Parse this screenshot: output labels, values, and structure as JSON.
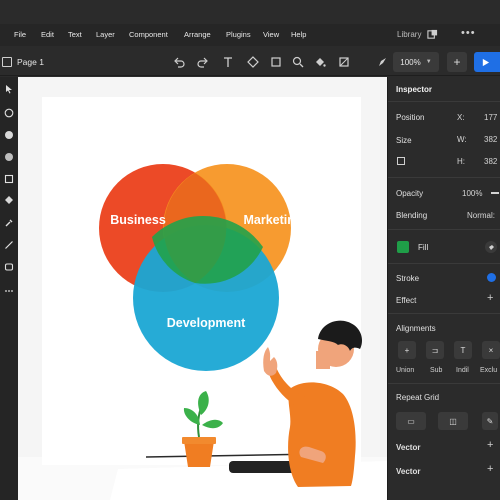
{
  "menu": {
    "items": [
      "File",
      "Edit",
      "Text",
      "Layer",
      "Component",
      "Arrange",
      "Plugins",
      "View",
      "Help"
    ],
    "library_label": "Library",
    "more_glyph": "•••"
  },
  "toolbar": {
    "page_label": "Page 1",
    "zoom_value": "100%",
    "add_glyph": "+"
  },
  "canvas": {
    "venn": {
      "labels": [
        "Business",
        "Marketing",
        "Development"
      ],
      "colors": [
        "#ec4a27",
        "#f6921e",
        "#1aa6d4"
      ]
    }
  },
  "inspector": {
    "title": "Inspector",
    "position_label": "Position",
    "x_label": "X:",
    "x_value": "177",
    "size_label": "Size",
    "w_label": "W:",
    "w_value": "382",
    "h_label": "H:",
    "h_value": "382",
    "opacity_label": "Opacity",
    "opacity_value": "100%",
    "blending_label": "Blending",
    "blending_value": "Normal:",
    "fill_label": "Fill",
    "fill_color": "#1f9e48",
    "stroke_label": "Stroke",
    "effect_label": "Effect",
    "alignments_label": "Alignments",
    "boolean_ops": [
      "Union",
      "Sub",
      "Indil",
      "Exclu"
    ],
    "repeat_grid_label": "Repeat Grid",
    "vector_labels": [
      "Vector",
      "Vector"
    ]
  },
  "colors": {
    "accent": "#1f6fe5",
    "panel": "#2b2b2b"
  }
}
